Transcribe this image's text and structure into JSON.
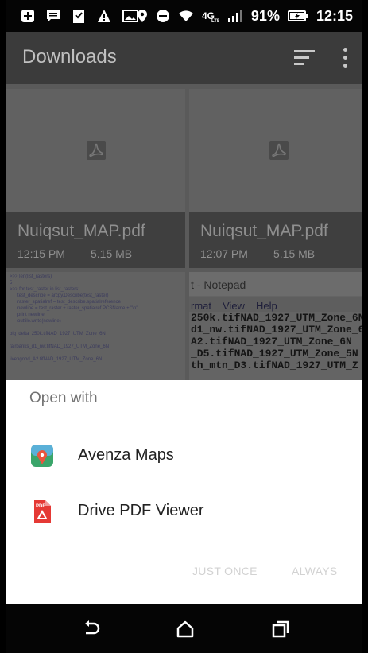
{
  "status_bar": {
    "battery_percent": "91%",
    "time": "12:15"
  },
  "toolbar": {
    "title": "Downloads",
    "sort_icon": "sort-icon",
    "menu_icon": "overflow-menu-icon"
  },
  "files": [
    {
      "name": "Nuiqsut_MAP.pdf",
      "time": "12:15 PM",
      "size": "5.15 MB"
    },
    {
      "name": "Nuiqsut_MAP.pdf",
      "time": "12:07 PM",
      "size": "5.15 MB"
    }
  ],
  "thumbnails": {
    "code_lines": [
      ">>> len(list_rasters)",
      "5",
      ">>> for test_raster in list_rasters:",
      "      test_describe = arcpy.Describe(test_raster)",
      "      raster_spatialref = test_describe.spatialreference",
      "      newline = test_raster + raster_spatialref.PCSName + \"\\n\"",
      "      print newline",
      "      outfile.write(newline)",
      "",
      "big_delta_250k.tifNAD_1927_UTM_Zone_6N",
      "",
      "fairbanks_d1_nw.tifNAD_1927_UTM_Zone_6N",
      "",
      "livengood_A2.tifNAD_1927_UTM_Zone_6N"
    ],
    "notepad_title": "t - Notepad",
    "notepad_menu": [
      "rmat",
      "View",
      "Help"
    ],
    "notepad_lines": [
      "250k.tifNAD_1927_UTM_Zone_6N",
      "d1_nw.tifNAD_1927_UTM_Zone_6",
      "A2.tifNAD_1927_UTM_Zone_6N",
      "_D5.tifNAD_1927_UTM_Zone_5N",
      "th_mtn_D3.tifNAD_1927_UTM_Z"
    ]
  },
  "chooser": {
    "header": "Open with",
    "apps": [
      {
        "label": "Avenza Maps",
        "icon": "avenza-maps-icon"
      },
      {
        "label": "Drive PDF Viewer",
        "icon": "drive-pdf-viewer-icon"
      }
    ],
    "just_once": "JUST ONCE",
    "always": "ALWAYS"
  },
  "nav_bar": {
    "back_icon": "back-icon",
    "home_icon": "home-icon",
    "recents_icon": "recents-icon"
  }
}
